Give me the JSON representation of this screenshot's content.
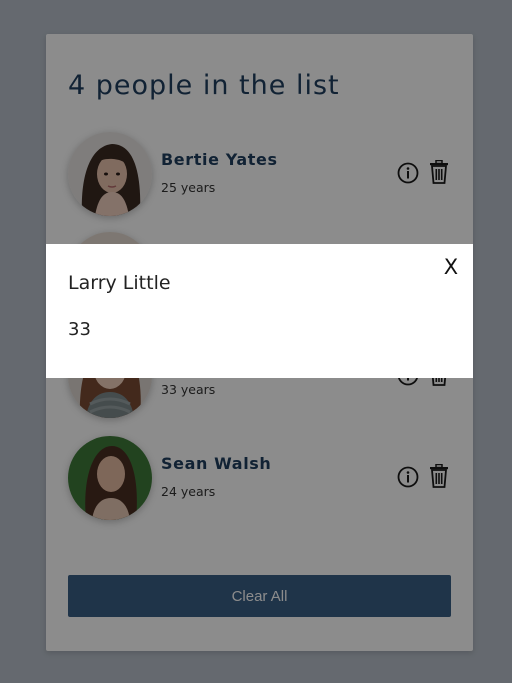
{
  "list": {
    "title": "4 people in the list",
    "people": [
      {
        "name": "Bertie Yates",
        "age_label": "25 years"
      },
      {
        "name": "",
        "age_label": ""
      },
      {
        "name": "",
        "age_label": "33 years"
      },
      {
        "name": "Sean Walsh",
        "age_label": "24 years"
      }
    ],
    "clear_label": "Clear All"
  },
  "modal": {
    "name": "Larry Little",
    "age": "33",
    "close_label": "X"
  },
  "icons": {
    "info": "info-circle-icon",
    "delete": "trash-icon",
    "close": "close-icon"
  },
  "colors": {
    "accent": "#1f3f5f",
    "button": "#3a5f86",
    "backdrop": "#b8c0ca"
  }
}
